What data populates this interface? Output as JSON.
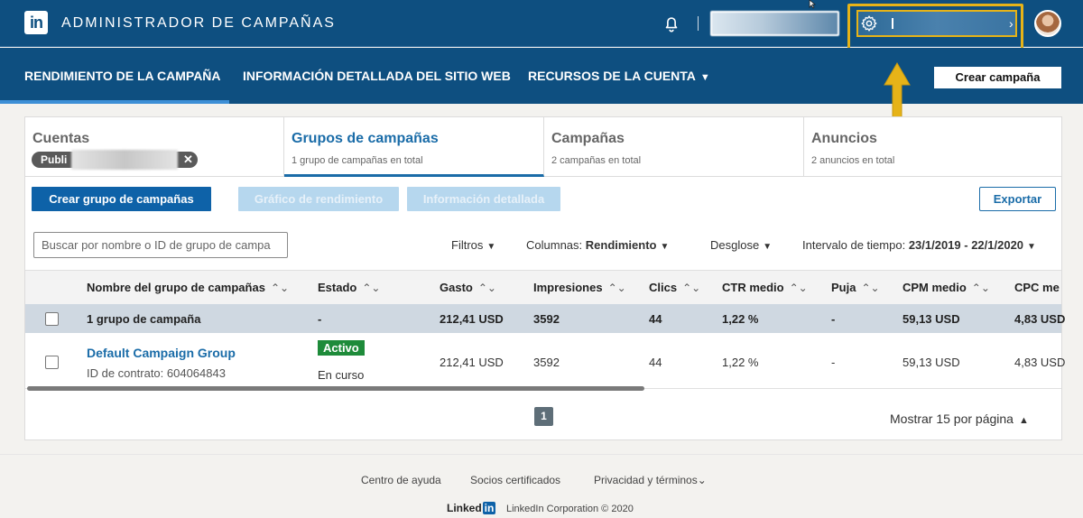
{
  "header": {
    "app_title": "ADMINISTRADOR DE CAMPAÑAS",
    "logo_text": "in",
    "icons": [
      "linkedin-logo-icon",
      "bell-icon",
      "gear-icon",
      "chevron-down-icon",
      "avatar"
    ],
    "accent_color": "#e6b318"
  },
  "nav": {
    "items": [
      {
        "label": "RENDIMIENTO DE LA CAMPAÑA"
      },
      {
        "label": "INFORMACIÓN DETALLADA DEL SITIO WEB"
      },
      {
        "label": "RECURSOS DE LA CUENTA"
      }
    ],
    "create_label": "Crear campaña"
  },
  "tabs": [
    {
      "title": "Cuentas",
      "chip": "Publi"
    },
    {
      "title": "Grupos de campañas",
      "subtitle": "1 grupo de campañas en total"
    },
    {
      "title": "Campañas",
      "subtitle": "2 campañas en total"
    },
    {
      "title": "Anuncios",
      "subtitle": "2 anuncios en total"
    }
  ],
  "toolbar": {
    "create_group": "Crear grupo de campañas",
    "perf_chart": "Gráfico de rendimiento",
    "detailed_info": "Información detallada",
    "export": "Exportar",
    "search_placeholder": "Buscar por nombre o ID de grupo de campa",
    "filters": "Filtros",
    "columns_label": "Columnas:",
    "columns_value": "Rendimiento",
    "breakdown": "Desglose",
    "range_label": "Intervalo de tiempo:",
    "range_value": "23/1/2019 - 22/1/2020"
  },
  "table": {
    "headers": [
      "Nombre del grupo de campañas",
      "Estado",
      "Gasto",
      "Impresiones",
      "Clics",
      "CTR medio",
      "Puja",
      "CPM medio",
      "CPC me"
    ],
    "summary": {
      "name": "1 grupo de campaña",
      "status": "-",
      "spend": "212,41 USD",
      "impressions": "3592",
      "clicks": "44",
      "ctr": "1,22 %",
      "bid": "-",
      "cpm": "59,13 USD",
      "cpc": "4,83 USD"
    },
    "rows": [
      {
        "name": "Default Campaign Group",
        "contract": "ID de contrato: 604064843",
        "status_badge": "Activo",
        "status_text": "En curso",
        "spend": "212,41 USD",
        "impressions": "3592",
        "clicks": "44",
        "ctr": "1,22 %",
        "bid": "-",
        "cpm": "59,13 USD",
        "cpc": "4,83 USD"
      }
    ]
  },
  "pagination": {
    "current_page": "1",
    "per_page": "Mostrar 15 por página"
  },
  "footer": {
    "links": [
      "Centro de ayuda",
      "Socios certificados",
      "Privacidad y términos"
    ],
    "logo_text": "Linked",
    "logo_in": "in",
    "copyright": "LinkedIn Corporation © 2020"
  }
}
